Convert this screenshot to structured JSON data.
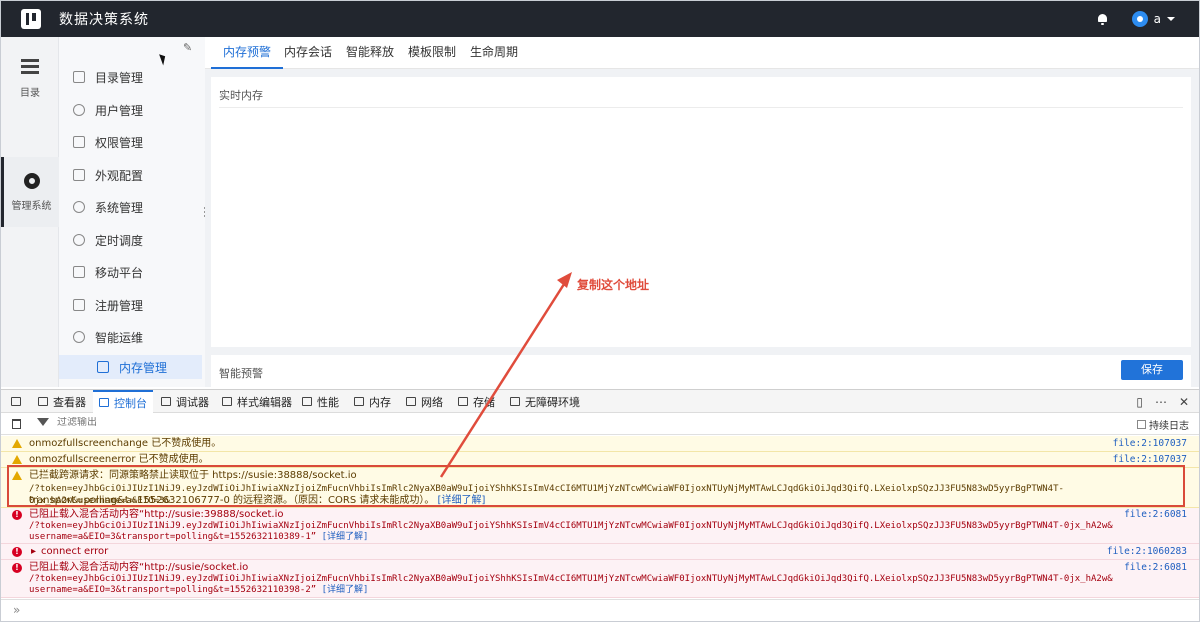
{
  "app": {
    "title": "数据决策系统",
    "user": "a"
  },
  "rail": {
    "items": [
      {
        "label": "目录"
      },
      {
        "label": "管理系统"
      }
    ]
  },
  "submenu": {
    "items": [
      {
        "label": "目录管理"
      },
      {
        "label": "用户管理"
      },
      {
        "label": "权限管理"
      },
      {
        "label": "外观配置"
      },
      {
        "label": "系统管理"
      },
      {
        "label": "定时调度"
      },
      {
        "label": "移动平台"
      },
      {
        "label": "注册管理"
      },
      {
        "label": "智能运维"
      }
    ],
    "active": {
      "label": "内存管理"
    }
  },
  "tabs": [
    {
      "label": "内存预警"
    },
    {
      "label": "内存会话"
    },
    {
      "label": "智能释放"
    },
    {
      "label": "模板限制"
    },
    {
      "label": "生命周期"
    }
  ],
  "main": {
    "panel1_title": "实时内存",
    "panel2_title": "智能预警",
    "save_label": "保存"
  },
  "devtools": {
    "tabs": [
      {
        "label": "查看器"
      },
      {
        "label": "控制台"
      },
      {
        "label": "调试器"
      },
      {
        "label": "样式编辑器"
      },
      {
        "label": "性能"
      },
      {
        "label": "内存"
      },
      {
        "label": "网络"
      },
      {
        "label": "存储"
      },
      {
        "label": "无障碍环境"
      }
    ],
    "filter_placeholder": "过滤输出",
    "persist_label": "持续日志",
    "messages": [
      {
        "text": "onmozfullscreenchange 已不赞成使用。",
        "source": "file:2:107037"
      },
      {
        "text": "onmozfullscreenerror 已不赞成使用。",
        "source": "file:2:107037"
      },
      {
        "line1": "已拦截跨源请求：同源策略禁止读取位于 https://susie:38888/socket.io",
        "line2": "/?token=eyJhbGciOiJIUzI1NiJ9.eyJzdWIiOiJhIiwiaXNzIjoiZmFucnVhbiIsImRlc2NyaXB0aW9uIjoiYShhKSIsImV4cCI6MTU1MjYzNTcwMCwiaWF0IjoxNTUyNjMyMTAwLCJqdGkiOiJqd3QifQ.LXeiolxpSQzJJ3FU5N83wD5yyrBgPTWN4T-0jx_hA2w&username=a&EIO=3&",
        "line3": "transport=polling&t=1552632106777-0 的远程资源。（原因：CORS 请求未能成功）。",
        "link": "[详细了解]"
      },
      {
        "line1": "已阻止载入混合活动内容“http://susie:39888/socket.io",
        "line2": "/?token=eyJhbGciOiJIUzI1NiJ9.eyJzdWIiOiJhIiwiaXNzIjoiZmFucnVhbiIsImRlc2NyaXB0aW9uIjoiYShhKSIsImV4cCI6MTU1MjYzNTcwMCwiaWF0IjoxNTUyNjMyMTAwLCJqdGkiOiJqd3QifQ.LXeiolxpSQzJJ3FU5N83wD5yyrBgPTWN4T-0jx_hA2w&",
        "line3": "username=a&EIO=3&transport=polling&t=1552632110389-1”",
        "link": "[详细了解]",
        "source": "file:2:6081"
      },
      {
        "text": "connect error",
        "source": "file:2:1060283"
      },
      {
        "line1": "已阻止载入混合活动内容“http://susie/socket.io",
        "line2": "/?token=eyJhbGciOiJIUzI1NiJ9.eyJzdWIiOiJhIiwiaXNzIjoiZmFucnVhbiIsImRlc2NyaXB0aW9uIjoiYShhKSIsImV4cCI6MTU1MjYzNTcwMCwiaWF0IjoxNTUyNjMyMTAwLCJqdGkiOiJqd3QifQ.LXeiolxpSQzJJ3FU5N83wD5yyrBgPTWN4T-0jx_hA2w&",
        "line3": "username=a&EIO=3&transport=polling&t=1552632110398-2”",
        "link": "[详细了解]",
        "source": "file:2:6081"
      }
    ],
    "prompt": "»"
  },
  "annotation": {
    "text": "复制这个地址",
    "color": "#e04c3c"
  }
}
